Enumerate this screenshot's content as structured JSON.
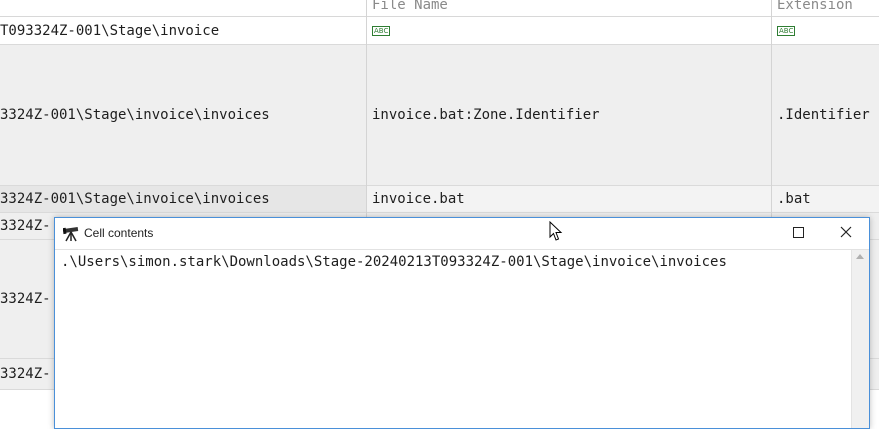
{
  "grid": {
    "columns": [
      {
        "label": ""
      },
      {
        "label": "File Name"
      },
      {
        "label": "Extension"
      }
    ],
    "filter_row": {
      "path": "T093324Z-001\\Stage\\invoice",
      "file_name_icon": "abc-filter-icon",
      "extension_icon": "abc-filter-icon"
    },
    "rows": [
      {
        "path": "3324Z-001\\Stage\\invoice\\invoices",
        "file_name": "invoice.bat:Zone.Identifier",
        "extension": ".Identifier"
      },
      {
        "path": "3324Z-001\\Stage\\invoice\\invoices",
        "file_name": "invoice.bat",
        "extension": ".bat"
      },
      {
        "path": "3324Z-",
        "file_name": "",
        "extension": ""
      },
      {
        "path": "3324Z-",
        "file_name": "",
        "extension": ""
      },
      {
        "path": "3324Z-",
        "file_name": "",
        "extension": ""
      }
    ]
  },
  "dialog": {
    "title": "Cell contents",
    "icon": "telescope-icon",
    "content": ".\\Users\\simon.stark\\Downloads\\Stage-20240213T093324Z-001\\Stage\\invoice\\invoices"
  }
}
